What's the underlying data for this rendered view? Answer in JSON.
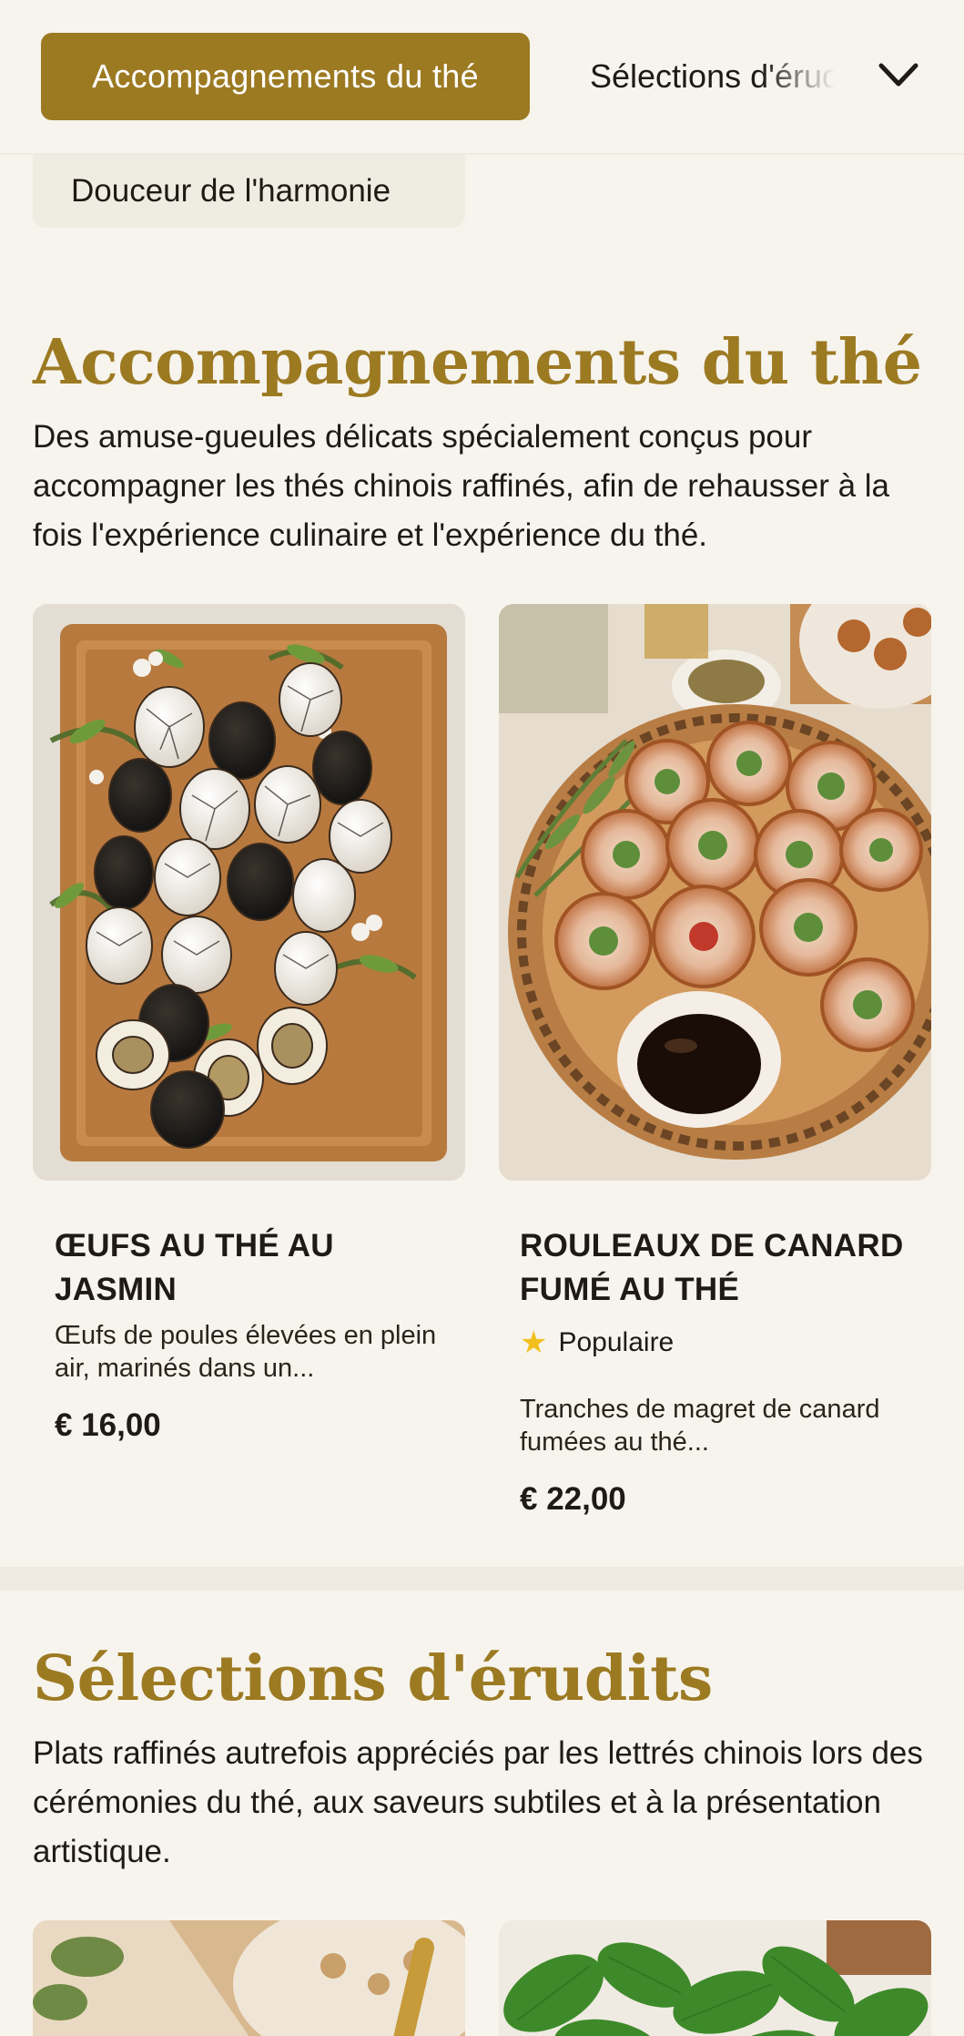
{
  "nav": {
    "active_tab": "Accompagnements du thé",
    "next_tab": "Sélections d'érudits",
    "subcategory": "Douceur de l'harmonie"
  },
  "sections": [
    {
      "title": "Accompagnements du thé",
      "description": "Des amuse-gueules délicats spécialement conçus pour accompagner les thés chinois raffinés, afin de rehausser à la fois l'expérience culinaire et l'expérience du thé.",
      "items": [
        {
          "name": "ŒUFS AU THÉ AU JASMIN",
          "description": "Œufs de poules élevées en plein air, marinés dans un...",
          "price": "€ 16,00",
          "image_icon": "tea-eggs-photo"
        },
        {
          "name": "ROULEAUX DE CANARD FUMÉ AU THÉ",
          "badge": "Populaire",
          "description": "Tranches de magret de canard fumées au thé...",
          "price": "€ 22,00",
          "image_icon": "duck-rolls-photo"
        }
      ]
    },
    {
      "title": "Sélections d'érudits",
      "description": "Plats raffinés autrefois appréciés par les lettrés chinois lors des cérémonies du thé, aux saveurs subtiles et à la présentation artistique."
    }
  ],
  "colors": {
    "accent": "#9c7a22",
    "background": "#f7f4ee",
    "star": "#f2bf1e"
  }
}
